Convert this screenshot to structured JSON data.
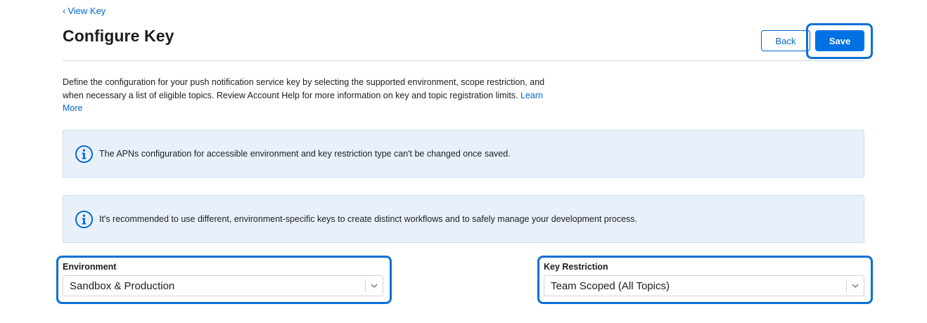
{
  "nav": {
    "back_link_chevron": "‹",
    "back_link_label": "View Key"
  },
  "header": {
    "title": "Configure Key"
  },
  "actions": {
    "back_label": "Back",
    "save_label": "Save"
  },
  "description": {
    "text": "Define the configuration for your push notification service key by selecting the supported environment, scope restriction, and when necessary a list of eligible topics. Review Account Help for more information on key and topic registration limits.",
    "link_label": "Learn More"
  },
  "notices": [
    {
      "icon": "info-icon",
      "text": "The APNs configuration for accessible environment and key restriction type can't be changed once saved."
    },
    {
      "icon": "info-icon",
      "text": "It's recommended to use different, environment-specific keys to create distinct workflows and to safely manage your development process."
    }
  ],
  "environment": {
    "label": "Environment",
    "value": "Sandbox & Production"
  },
  "key_restriction": {
    "label": "Key Restriction",
    "value": "Team Scoped (All Topics)"
  },
  "colors": {
    "accent": "#0071e3",
    "link": "#0066cc",
    "notice_bg": "#e8f1fb",
    "focus_ring": "#0a70d6"
  }
}
